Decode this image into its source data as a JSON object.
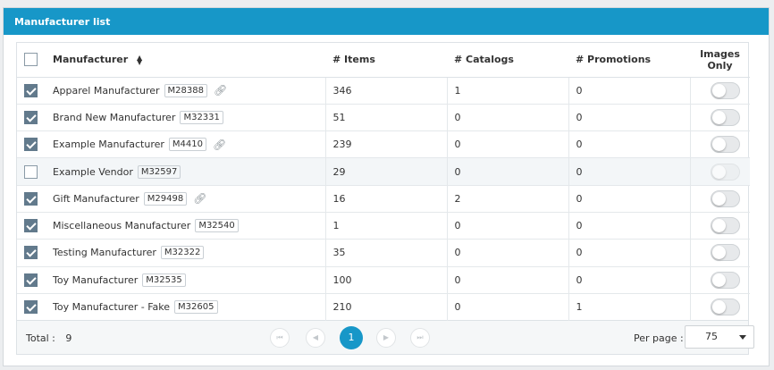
{
  "panel": {
    "title": "Manufacturer list"
  },
  "table": {
    "headers": {
      "manufacturer": "Manufacturer",
      "items": "# Items",
      "catalogs": "# Catalogs",
      "promotions": "# Promotions",
      "images_only": "Images Only"
    },
    "rows": [
      {
        "name": "Apparel Manufacturer",
        "code": "M28388",
        "link": true,
        "items": "346",
        "catalogs": "1",
        "promotions": "0",
        "checked": true,
        "images_only": false
      },
      {
        "name": "Brand New Manufacturer",
        "code": "M32331",
        "link": false,
        "items": "51",
        "catalogs": "0",
        "promotions": "0",
        "checked": true,
        "images_only": false
      },
      {
        "name": "Example Manufacturer",
        "code": "M4410",
        "link": true,
        "items": "239",
        "catalogs": "0",
        "promotions": "0",
        "checked": true,
        "images_only": false
      },
      {
        "name": "Example Vendor",
        "code": "M32597",
        "link": false,
        "items": "29",
        "catalogs": "0",
        "promotions": "0",
        "checked": false,
        "images_only": false
      },
      {
        "name": "Gift Manufacturer",
        "code": "M29498",
        "link": true,
        "items": "16",
        "catalogs": "2",
        "promotions": "0",
        "checked": true,
        "images_only": false
      },
      {
        "name": "Miscellaneous Manufacturer",
        "code": "M32540",
        "link": false,
        "items": "1",
        "catalogs": "0",
        "promotions": "0",
        "checked": true,
        "images_only": false
      },
      {
        "name": "Testing Manufacturer",
        "code": "M32322",
        "link": false,
        "items": "35",
        "catalogs": "0",
        "promotions": "0",
        "checked": true,
        "images_only": false
      },
      {
        "name": "Toy Manufacturer",
        "code": "M32535",
        "link": false,
        "items": "100",
        "catalogs": "0",
        "promotions": "0",
        "checked": true,
        "images_only": false
      },
      {
        "name": "Toy Manufacturer - Fake",
        "code": "M32605",
        "link": false,
        "items": "210",
        "catalogs": "0",
        "promotions": "1",
        "checked": true,
        "images_only": false
      }
    ]
  },
  "footer": {
    "total_label": "Total :",
    "total_value": "9",
    "current_page": "1",
    "per_page_label": "Per page :",
    "per_page_value": "75"
  },
  "colors": {
    "accent": "#1797c8",
    "checkbox": "#627a8c"
  },
  "icons": {
    "sort": "sort-icon",
    "link": "link-icon",
    "first": "first-page-icon",
    "prev": "prev-page-icon",
    "next": "next-page-icon",
    "last": "last-page-icon",
    "caret": "chevron-down-icon"
  }
}
